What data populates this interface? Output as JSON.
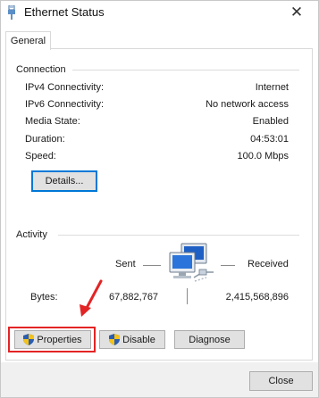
{
  "window": {
    "title": "Ethernet Status",
    "close_glyph": "✕"
  },
  "tabs": [
    {
      "label": "General",
      "selected": true
    }
  ],
  "connection": {
    "heading": "Connection",
    "rows": [
      {
        "label": "IPv4 Connectivity:",
        "value": "Internet"
      },
      {
        "label": "IPv6 Connectivity:",
        "value": "No network access"
      },
      {
        "label": "Media State:",
        "value": "Enabled"
      },
      {
        "label": "Duration:",
        "value": "04:53:01"
      },
      {
        "label": "Speed:",
        "value": "100.0 Mbps"
      }
    ],
    "details_button": "Details..."
  },
  "activity": {
    "heading": "Activity",
    "sent_label": "Sent",
    "received_label": "Received",
    "bytes_label": "Bytes:",
    "bytes_sent": "67,882,767",
    "bytes_received": "2,415,568,896",
    "icon": "network-computers-icon"
  },
  "actions": {
    "properties": "Properties",
    "disable": "Disable",
    "diagnose": "Diagnose"
  },
  "footer": {
    "close": "Close"
  },
  "annotation": {
    "highlight_color": "#e32424"
  },
  "colors": {
    "focus_border": "#0078d7",
    "button_bg": "#e1e1e1",
    "button_border": "#adadad",
    "window_bg": "#ffffff",
    "chrome_bg": "#f0f0f0"
  }
}
